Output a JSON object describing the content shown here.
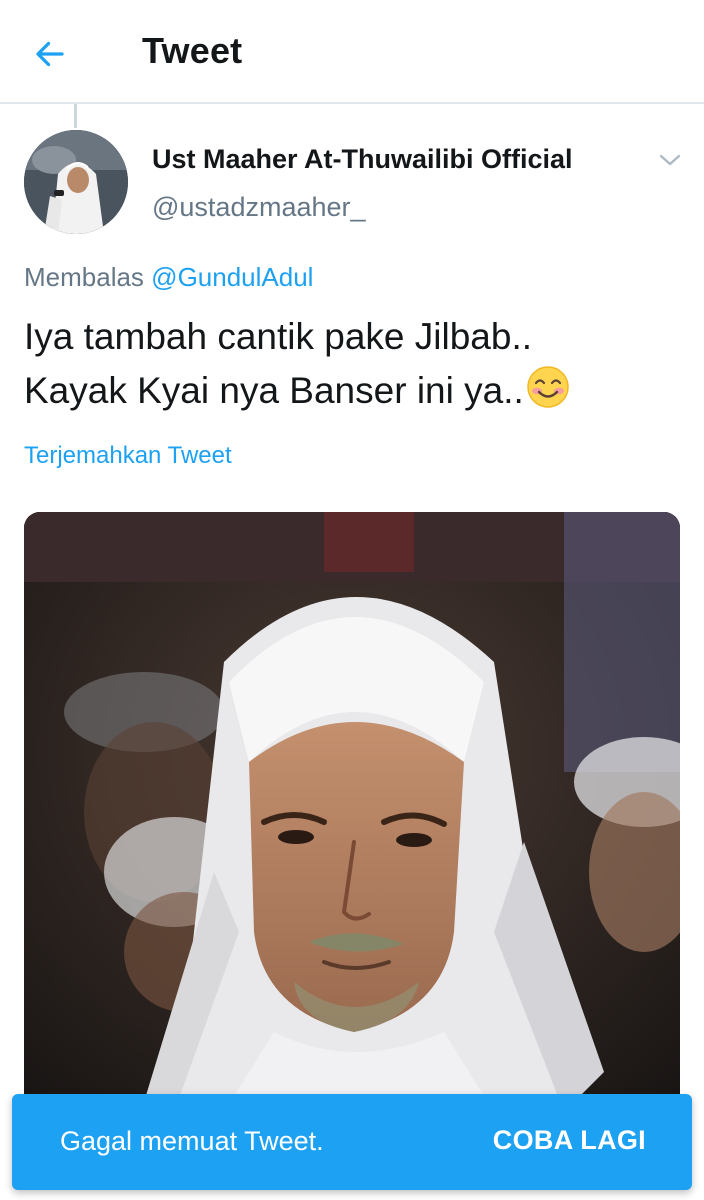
{
  "header": {
    "title": "Tweet",
    "back_icon": "arrow-left-icon",
    "accent_color": "#1da1f2"
  },
  "tweet": {
    "author": {
      "name": "Ust Maaher At-Thuwailibi Official",
      "handle": "@ustadzmaaher_"
    },
    "reply_prefix": "Membalas",
    "reply_to": "@GundulAdul",
    "text_line1": "Iya tambah cantik pake Jilbab..",
    "text_line2": "Kayak Kyai nya Banser ini ya..",
    "emoji": "smiling-face-with-blush",
    "translate_label": "Terjemahkan Tweet",
    "media_icon": "photo"
  },
  "toast": {
    "message": "Gagal memuat Tweet.",
    "action_label": "COBA LAGI",
    "background": "#1da1f2"
  }
}
